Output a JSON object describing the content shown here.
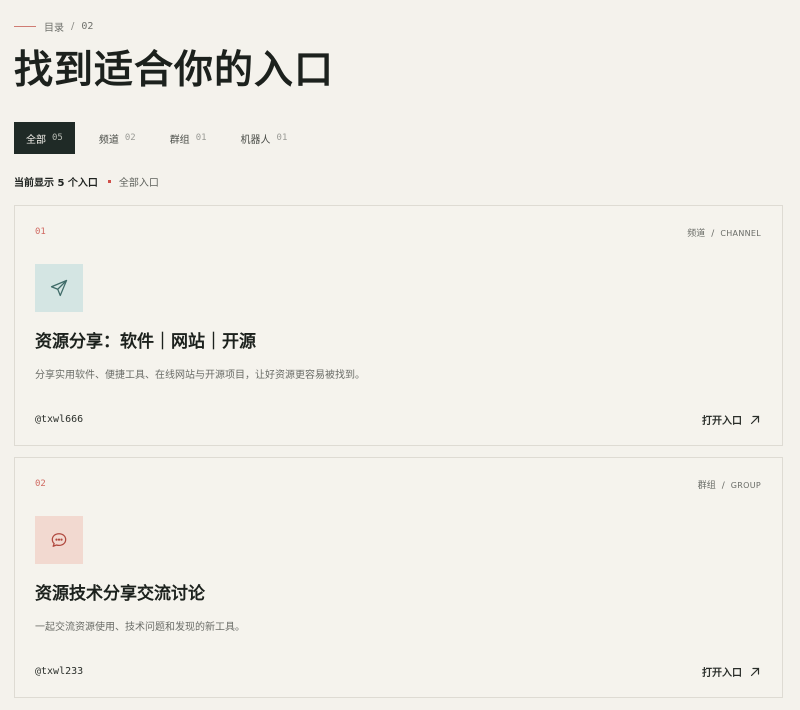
{
  "breadcrumb": {
    "label": "目录",
    "separator": "/",
    "number": "02"
  },
  "page": {
    "title": "找到适合你的入口"
  },
  "tabs": [
    {
      "label": "全部",
      "count": "05",
      "active": true
    },
    {
      "label": "频道",
      "count": "02",
      "active": false
    },
    {
      "label": "群组",
      "count": "01",
      "active": false
    },
    {
      "label": "机器人",
      "count": "01",
      "active": false
    }
  ],
  "filter": {
    "status": "当前显示 5 个入口",
    "current": "全部入口"
  },
  "cards": [
    {
      "index": "01",
      "type_cn": "频道",
      "type_sep": "/",
      "type_en": "CHANNEL",
      "icon": "send-icon",
      "title": "资源分享：软件｜网站｜开源",
      "description": "分享实用软件、便捷工具、在线网站与开源项目，让好资源更容易被找到。",
      "handle": "@txwl666",
      "link_label": "打开入口"
    },
    {
      "index": "02",
      "type_cn": "群组",
      "type_sep": "/",
      "type_en": "GROUP",
      "icon": "chat-bubble-icon",
      "title": "资源技术分享交流讨论",
      "description": "一起交流资源使用、技术问题和发现的新工具。",
      "handle": "@txwl233",
      "link_label": "打开入口"
    }
  ],
  "colors": {
    "background": "#f4f2ec",
    "ink": "#1f2320",
    "accent_red": "#d0504a",
    "active_tab": "#1f2a26",
    "channel_icon_bg": "#d4e5e3",
    "group_icon_bg": "#f2d9d0"
  }
}
